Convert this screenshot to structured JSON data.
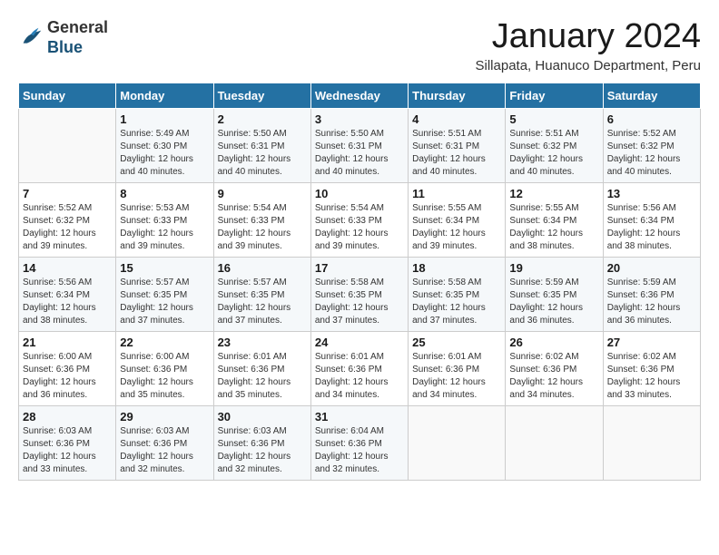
{
  "logo": {
    "general": "General",
    "blue": "Blue"
  },
  "header": {
    "title": "January 2024",
    "subtitle": "Sillapata, Huanuco Department, Peru"
  },
  "weekdays": [
    "Sunday",
    "Monday",
    "Tuesday",
    "Wednesday",
    "Thursday",
    "Friday",
    "Saturday"
  ],
  "weeks": [
    [
      {
        "day": "",
        "info": ""
      },
      {
        "day": "1",
        "info": "Sunrise: 5:49 AM\nSunset: 6:30 PM\nDaylight: 12 hours\nand 40 minutes."
      },
      {
        "day": "2",
        "info": "Sunrise: 5:50 AM\nSunset: 6:31 PM\nDaylight: 12 hours\nand 40 minutes."
      },
      {
        "day": "3",
        "info": "Sunrise: 5:50 AM\nSunset: 6:31 PM\nDaylight: 12 hours\nand 40 minutes."
      },
      {
        "day": "4",
        "info": "Sunrise: 5:51 AM\nSunset: 6:31 PM\nDaylight: 12 hours\nand 40 minutes."
      },
      {
        "day": "5",
        "info": "Sunrise: 5:51 AM\nSunset: 6:32 PM\nDaylight: 12 hours\nand 40 minutes."
      },
      {
        "day": "6",
        "info": "Sunrise: 5:52 AM\nSunset: 6:32 PM\nDaylight: 12 hours\nand 40 minutes."
      }
    ],
    [
      {
        "day": "7",
        "info": "Sunrise: 5:52 AM\nSunset: 6:32 PM\nDaylight: 12 hours\nand 39 minutes."
      },
      {
        "day": "8",
        "info": "Sunrise: 5:53 AM\nSunset: 6:33 PM\nDaylight: 12 hours\nand 39 minutes."
      },
      {
        "day": "9",
        "info": "Sunrise: 5:54 AM\nSunset: 6:33 PM\nDaylight: 12 hours\nand 39 minutes."
      },
      {
        "day": "10",
        "info": "Sunrise: 5:54 AM\nSunset: 6:33 PM\nDaylight: 12 hours\nand 39 minutes."
      },
      {
        "day": "11",
        "info": "Sunrise: 5:55 AM\nSunset: 6:34 PM\nDaylight: 12 hours\nand 39 minutes."
      },
      {
        "day": "12",
        "info": "Sunrise: 5:55 AM\nSunset: 6:34 PM\nDaylight: 12 hours\nand 38 minutes."
      },
      {
        "day": "13",
        "info": "Sunrise: 5:56 AM\nSunset: 6:34 PM\nDaylight: 12 hours\nand 38 minutes."
      }
    ],
    [
      {
        "day": "14",
        "info": "Sunrise: 5:56 AM\nSunset: 6:34 PM\nDaylight: 12 hours\nand 38 minutes."
      },
      {
        "day": "15",
        "info": "Sunrise: 5:57 AM\nSunset: 6:35 PM\nDaylight: 12 hours\nand 37 minutes."
      },
      {
        "day": "16",
        "info": "Sunrise: 5:57 AM\nSunset: 6:35 PM\nDaylight: 12 hours\nand 37 minutes."
      },
      {
        "day": "17",
        "info": "Sunrise: 5:58 AM\nSunset: 6:35 PM\nDaylight: 12 hours\nand 37 minutes."
      },
      {
        "day": "18",
        "info": "Sunrise: 5:58 AM\nSunset: 6:35 PM\nDaylight: 12 hours\nand 37 minutes."
      },
      {
        "day": "19",
        "info": "Sunrise: 5:59 AM\nSunset: 6:35 PM\nDaylight: 12 hours\nand 36 minutes."
      },
      {
        "day": "20",
        "info": "Sunrise: 5:59 AM\nSunset: 6:36 PM\nDaylight: 12 hours\nand 36 minutes."
      }
    ],
    [
      {
        "day": "21",
        "info": "Sunrise: 6:00 AM\nSunset: 6:36 PM\nDaylight: 12 hours\nand 36 minutes."
      },
      {
        "day": "22",
        "info": "Sunrise: 6:00 AM\nSunset: 6:36 PM\nDaylight: 12 hours\nand 35 minutes."
      },
      {
        "day": "23",
        "info": "Sunrise: 6:01 AM\nSunset: 6:36 PM\nDaylight: 12 hours\nand 35 minutes."
      },
      {
        "day": "24",
        "info": "Sunrise: 6:01 AM\nSunset: 6:36 PM\nDaylight: 12 hours\nand 34 minutes."
      },
      {
        "day": "25",
        "info": "Sunrise: 6:01 AM\nSunset: 6:36 PM\nDaylight: 12 hours\nand 34 minutes."
      },
      {
        "day": "26",
        "info": "Sunrise: 6:02 AM\nSunset: 6:36 PM\nDaylight: 12 hours\nand 34 minutes."
      },
      {
        "day": "27",
        "info": "Sunrise: 6:02 AM\nSunset: 6:36 PM\nDaylight: 12 hours\nand 33 minutes."
      }
    ],
    [
      {
        "day": "28",
        "info": "Sunrise: 6:03 AM\nSunset: 6:36 PM\nDaylight: 12 hours\nand 33 minutes."
      },
      {
        "day": "29",
        "info": "Sunrise: 6:03 AM\nSunset: 6:36 PM\nDaylight: 12 hours\nand 32 minutes."
      },
      {
        "day": "30",
        "info": "Sunrise: 6:03 AM\nSunset: 6:36 PM\nDaylight: 12 hours\nand 32 minutes."
      },
      {
        "day": "31",
        "info": "Sunrise: 6:04 AM\nSunset: 6:36 PM\nDaylight: 12 hours\nand 32 minutes."
      },
      {
        "day": "",
        "info": ""
      },
      {
        "day": "",
        "info": ""
      },
      {
        "day": "",
        "info": ""
      }
    ]
  ]
}
